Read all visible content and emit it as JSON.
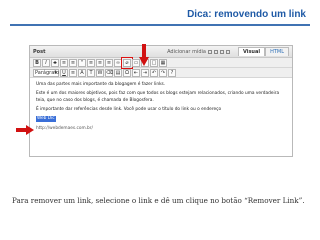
{
  "slide": {
    "title": "Dica: removendo um link",
    "caption": "Para remover um link, selecione o link e dê um clique no botão “Remover Link”."
  },
  "editor": {
    "post_label": "Post",
    "add_media_label": "Adicionar mídia",
    "tabs": [
      "Visual",
      "HTML"
    ],
    "format_select": "Parágrafo",
    "content": {
      "para1": "Uma das partes mais importante da blogagem é fazer links.",
      "para2": "Este é um dos maiores objetivos, pois faz com que todos os blogs estejam relacionados, criando uma verdadeira teia, que no caso dos blogs, é chamada de Blogosfera.",
      "para3": "É importante dar referências desde link. Você pode usar o título do link ou o endereço",
      "selected_link": "Web Dic",
      "url": "http://webdemaes.com.br/"
    }
  },
  "colors": {
    "accent": "#1f5aa6",
    "highlight": "#d11111",
    "selection": "#3a6fd8"
  }
}
